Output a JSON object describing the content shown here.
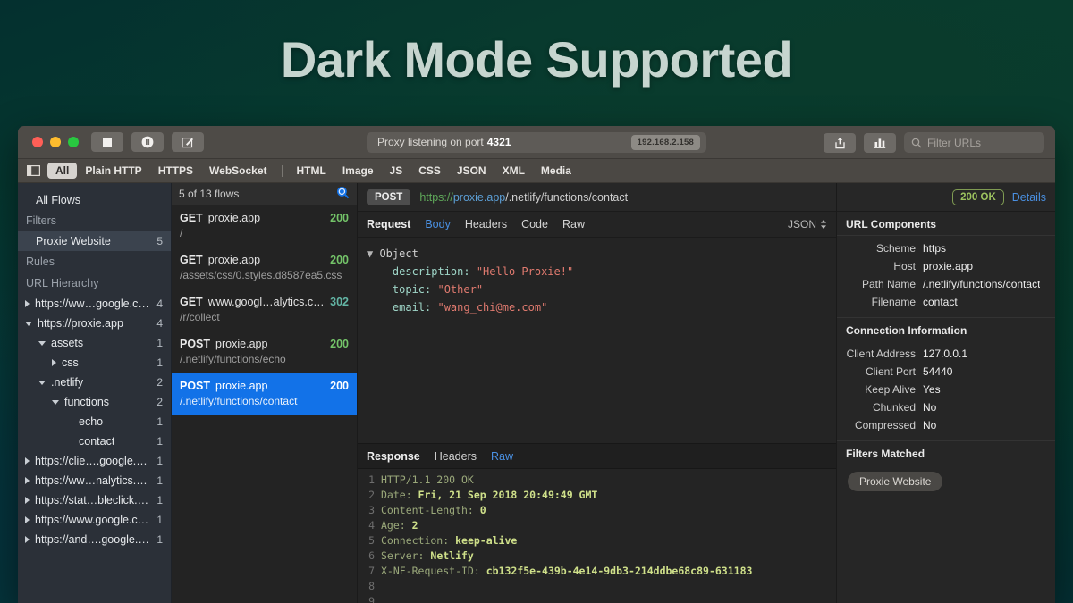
{
  "headline": "Dark Mode Supported",
  "titlebar": {
    "buttons": [
      {
        "name": "stop-button",
        "icon": "stop-icon"
      },
      {
        "name": "pause-button",
        "icon": "pause-icon"
      },
      {
        "name": "compose-button",
        "icon": "compose-icon"
      }
    ],
    "proxy_status_label": "Proxy listening on port",
    "proxy_port": "4321",
    "ip_badge": "192.168.2.158",
    "share_icon": "share-icon",
    "chart_icon": "bar-chart-icon",
    "filter_placeholder": "Filter URLs",
    "search_icon": "search-icon"
  },
  "filterbar": {
    "sidebar_toggle_icon": "sidebar-toggle-icon",
    "items": [
      {
        "label": "All",
        "active": true
      },
      {
        "label": "Plain HTTP",
        "active": false
      },
      {
        "label": "HTTPS",
        "active": false
      },
      {
        "label": "WebSocket",
        "active": false
      },
      {
        "label": "HTML",
        "active": false
      },
      {
        "label": "Image",
        "active": false
      },
      {
        "label": "JS",
        "active": false
      },
      {
        "label": "CSS",
        "active": false
      },
      {
        "label": "JSON",
        "active": false
      },
      {
        "label": "XML",
        "active": false
      },
      {
        "label": "Media",
        "active": false
      }
    ]
  },
  "sidebar": {
    "all_flows": "All Flows",
    "filters_heading": "Filters",
    "filters": [
      {
        "label": "Proxie Website",
        "count": "5",
        "selected": true
      }
    ],
    "rules_heading": "Rules",
    "hierarchy_heading": "URL Hierarchy",
    "hierarchy": [
      {
        "label": "https://ww…google.co.jp",
        "count": "4",
        "tri": "right",
        "indent": 0
      },
      {
        "label": "https://proxie.app",
        "count": "4",
        "tri": "down",
        "indent": 0
      },
      {
        "label": "assets",
        "count": "1",
        "tri": "down",
        "indent": 1
      },
      {
        "label": "css",
        "count": "1",
        "tri": "right",
        "indent": 2
      },
      {
        "label": ".netlify",
        "count": "2",
        "tri": "down",
        "indent": 1
      },
      {
        "label": "functions",
        "count": "2",
        "tri": "down",
        "indent": 2
      },
      {
        "label": "echo",
        "count": "1",
        "tri": "none",
        "indent": 3
      },
      {
        "label": "contact",
        "count": "1",
        "tri": "none",
        "indent": 3
      },
      {
        "label": "https://clie….google.com",
        "count": "1",
        "tri": "right",
        "indent": 0
      },
      {
        "label": "https://ww…nalytics.com",
        "count": "1",
        "tri": "right",
        "indent": 0
      },
      {
        "label": "https://stat…bleclick.net",
        "count": "1",
        "tri": "right",
        "indent": 0
      },
      {
        "label": "https://www.google.com",
        "count": "1",
        "tri": "right",
        "indent": 0
      },
      {
        "label": "https://and….google.com",
        "count": "1",
        "tri": "right",
        "indent": 0
      }
    ]
  },
  "flowlist": {
    "header": "5 of 13 flows",
    "search_icon": "search-icon",
    "flows": [
      {
        "method": "GET",
        "host": "proxie.app",
        "status": "200",
        "status_class": "s200",
        "path": "/",
        "selected": false
      },
      {
        "method": "GET",
        "host": "proxie.app",
        "status": "200",
        "status_class": "s200",
        "path": "/assets/css/0.styles.d8587ea5.css",
        "selected": false
      },
      {
        "method": "GET",
        "host": "www.googl…alytics.com",
        "status": "302",
        "status_class": "s302",
        "path": "/r/collect",
        "selected": false
      },
      {
        "method": "POST",
        "host": "proxie.app",
        "status": "200",
        "status_class": "s200",
        "path": "/.netlify/functions/echo",
        "selected": false
      },
      {
        "method": "POST",
        "host": "proxie.app",
        "status": "200",
        "status_class": "s200",
        "path": "/.netlify/functions/contact",
        "selected": true
      }
    ]
  },
  "detail": {
    "method": "POST",
    "url_scheme": "https://",
    "url_host": "proxie.app",
    "url_path": "/.netlify/functions/contact",
    "request_title": "Request",
    "request_tabs": [
      {
        "label": "Body",
        "active": true
      },
      {
        "label": "Headers",
        "active": false
      },
      {
        "label": "Code",
        "active": false
      },
      {
        "label": "Raw",
        "active": false
      }
    ],
    "format_label": "JSON",
    "format_icon": "chevron-updown-icon",
    "body_root": "Object",
    "body_fields": [
      {
        "key": "description",
        "value": "\"Hello Proxie!\""
      },
      {
        "key": "topic",
        "value": "\"Other\""
      },
      {
        "key": "email",
        "value": "\"wang_chi@me.com\""
      }
    ],
    "response_title": "Response",
    "response_tabs": [
      {
        "label": "Headers",
        "active": false
      },
      {
        "label": "Raw",
        "active": true
      }
    ],
    "response_raw": [
      {
        "n": "1",
        "k": "HTTP/1.1 200 OK",
        "v": ""
      },
      {
        "n": "2",
        "k": "Date: ",
        "v": "Fri, 21 Sep 2018 20:49:49 GMT"
      },
      {
        "n": "3",
        "k": "Content-Length: ",
        "v": "0"
      },
      {
        "n": "4",
        "k": "Age: ",
        "v": "2"
      },
      {
        "n": "5",
        "k": "Connection: ",
        "v": "keep-alive"
      },
      {
        "n": "6",
        "k": "Server: ",
        "v": "Netlify"
      },
      {
        "n": "7",
        "k": "X-NF-Request-ID: ",
        "v": "cb132f5e-439b-4e14-9db3-214ddbe68c89-631183"
      },
      {
        "n": "8",
        "k": "",
        "v": ""
      },
      {
        "n": "9",
        "k": "",
        "v": ""
      }
    ]
  },
  "rightpanel": {
    "status_badge": "200 OK",
    "details_link": "Details",
    "url_components_heading": "URL Components",
    "url_components": [
      {
        "label": "Scheme",
        "value": "https"
      },
      {
        "label": "Host",
        "value": "proxie.app"
      },
      {
        "label": "Path Name",
        "value": "/.netlify/functions/contact"
      },
      {
        "label": "Filename",
        "value": "contact"
      }
    ],
    "connection_heading": "Connection Information",
    "connection": [
      {
        "label": "Client Address",
        "value": "127.0.0.1"
      },
      {
        "label": "Client Port",
        "value": "54440"
      },
      {
        "label": "Keep Alive",
        "value": "Yes"
      },
      {
        "label": "Chunked",
        "value": "No"
      },
      {
        "label": "Compressed",
        "value": "No"
      }
    ],
    "filters_matched_heading": "Filters Matched",
    "filter_chip": "Proxie Website"
  },
  "colors": {
    "accent_blue": "#1272e8",
    "link_blue": "#4a90e2",
    "status_ok": "#74c469",
    "status_redirect": "#63b5a5",
    "badge_green": "#9dc25f"
  }
}
